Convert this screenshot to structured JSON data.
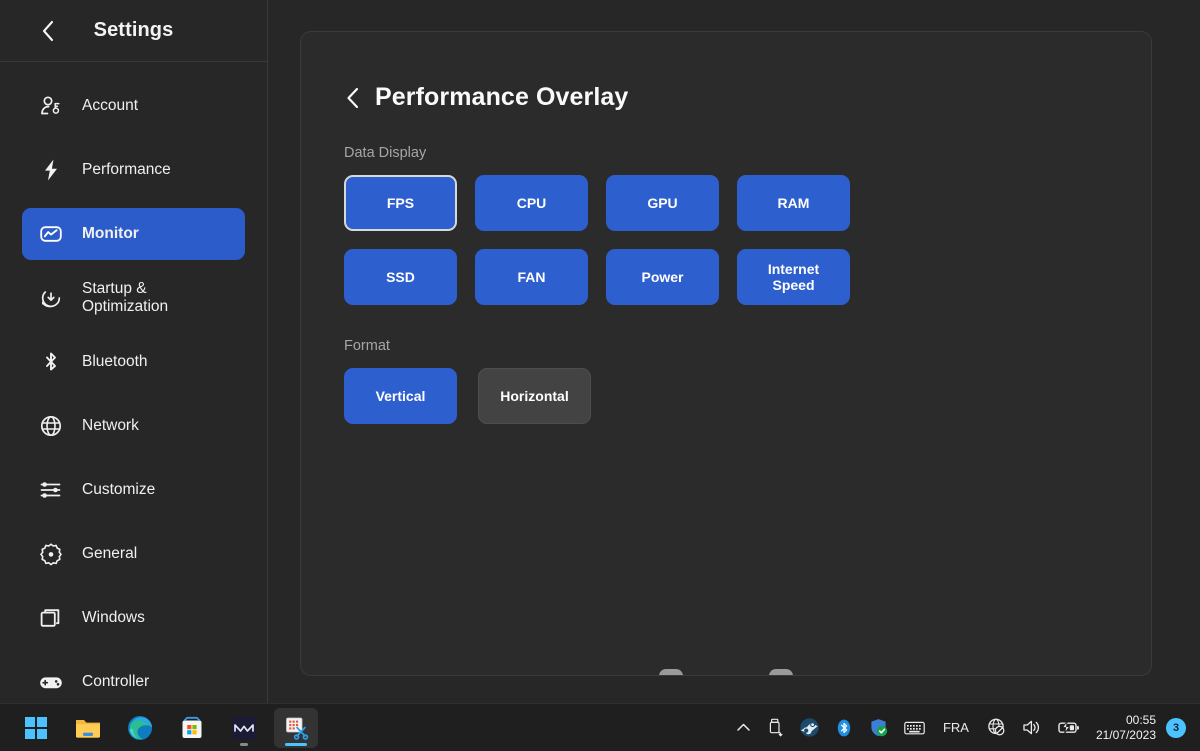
{
  "sidebar": {
    "title": "Settings",
    "back_icon": "chevron-left-icon",
    "items": [
      {
        "label": "Account",
        "icon": "account-icon",
        "active": false
      },
      {
        "label": "Performance",
        "icon": "lightning-bolt-icon",
        "active": false
      },
      {
        "label": "Monitor",
        "icon": "monitor-chart-icon",
        "active": true
      },
      {
        "label": "Startup &\nOptimization",
        "icon": "startup-download-icon",
        "active": false
      },
      {
        "label": "Bluetooth",
        "icon": "bluetooth-icon",
        "active": false
      },
      {
        "label": "Network",
        "icon": "globe-icon",
        "active": false
      },
      {
        "label": "Customize",
        "icon": "sliders-icon",
        "active": false
      },
      {
        "label": "General",
        "icon": "gear-icon",
        "active": false
      },
      {
        "label": "Windows",
        "icon": "windows-stack-icon",
        "active": false
      },
      {
        "label": "Controller",
        "icon": "gamepad-icon",
        "active": false
      }
    ]
  },
  "page": {
    "back_icon": "chevron-left-icon",
    "title": "Performance Overlay",
    "sections": [
      {
        "label": "Data Display",
        "tiles": [
          {
            "label": "FPS",
            "selected": true,
            "focused": true
          },
          {
            "label": "CPU",
            "selected": true,
            "focused": false
          },
          {
            "label": "GPU",
            "selected": true,
            "focused": false
          },
          {
            "label": "RAM",
            "selected": true,
            "focused": false
          },
          {
            "label": "SSD",
            "selected": true,
            "focused": false
          },
          {
            "label": "FAN",
            "selected": true,
            "focused": false
          },
          {
            "label": "Power",
            "selected": true,
            "focused": false
          },
          {
            "label": "Internet\nSpeed",
            "selected": true,
            "focused": false
          }
        ]
      },
      {
        "label": "Format",
        "options": [
          {
            "label": "Vertical",
            "selected": true
          },
          {
            "label": "Horizontal",
            "selected": false
          }
        ]
      }
    ]
  },
  "taskbar": {
    "apps": [
      {
        "name": "start-button",
        "icon": "windows-logo-icon",
        "active": false,
        "running": false
      },
      {
        "name": "file-explorer",
        "icon": "folder-icon",
        "active": false,
        "running": false
      },
      {
        "name": "microsoft-edge",
        "icon": "edge-icon",
        "active": false,
        "running": false
      },
      {
        "name": "microsoft-store",
        "icon": "store-icon",
        "active": false,
        "running": false
      },
      {
        "name": "mail-app",
        "icon": "mail-icon",
        "active": false,
        "running": true
      },
      {
        "name": "snipping-tool",
        "icon": "snipping-tool-icon",
        "active": true,
        "running": true
      }
    ],
    "tray": [
      {
        "name": "show-hidden-icons",
        "icon": "chevron-up-icon"
      },
      {
        "name": "safely-remove-hardware",
        "icon": "usb-icon"
      },
      {
        "name": "steam",
        "icon": "steam-icon"
      },
      {
        "name": "bluetooth",
        "icon": "bluetooth-icon"
      },
      {
        "name": "windows-security",
        "icon": "shield-check-icon"
      },
      {
        "name": "touch-keyboard",
        "icon": "keyboard-icon"
      }
    ],
    "language": "FRA",
    "status": [
      {
        "name": "network",
        "icon": "globe-disconnected-icon"
      },
      {
        "name": "volume",
        "icon": "speaker-icon"
      },
      {
        "name": "battery",
        "icon": "battery-charging-icon"
      }
    ],
    "clock": {
      "time": "00:55",
      "date": "21/07/2023"
    },
    "notification_count": "3"
  },
  "colors": {
    "accent_blue": "#2e5fce",
    "sidebar_active": "#2b5cc9",
    "panel_bg": "#2b2b2b",
    "window_bg": "#272727",
    "taskbar_bg": "#1f1f1f",
    "badge_blue": "#4cc2ff",
    "muted_text": "#a6a6a6"
  }
}
